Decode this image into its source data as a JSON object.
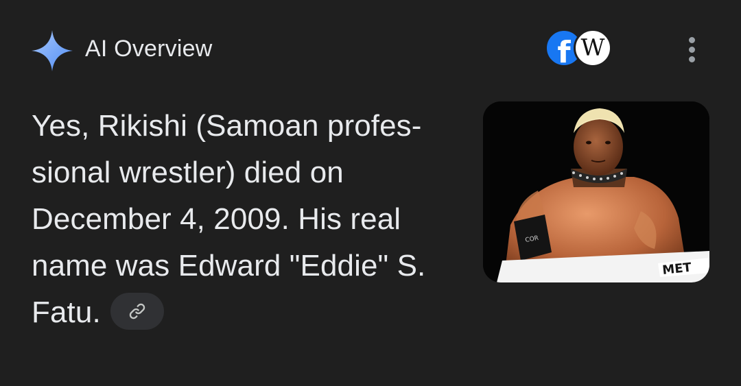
{
  "header": {
    "title": "AI Overview",
    "sparkle_icon": "sparkle-icon",
    "sources": [
      {
        "name": "facebook",
        "glyph": "f",
        "color": "#1877f2"
      },
      {
        "name": "wikipedia",
        "glyph": "W",
        "color": "#ffffff"
      }
    ],
    "menu_icon": "more-vert-icon"
  },
  "answer": {
    "lines": [
      "Yes, Rikishi (Samoan profes-",
      "sional wrestler) died on",
      "December 4, 2009. His real",
      "name was Edward \"Eddie\" S.",
      "Fatu."
    ],
    "link_icon": "link-icon"
  },
  "image": {
    "overlay_text": "MET"
  },
  "colors": {
    "background": "#1f1f1f",
    "text": "#e8eaed",
    "sparkle": "#8ab4f8",
    "chip": "#303134"
  }
}
